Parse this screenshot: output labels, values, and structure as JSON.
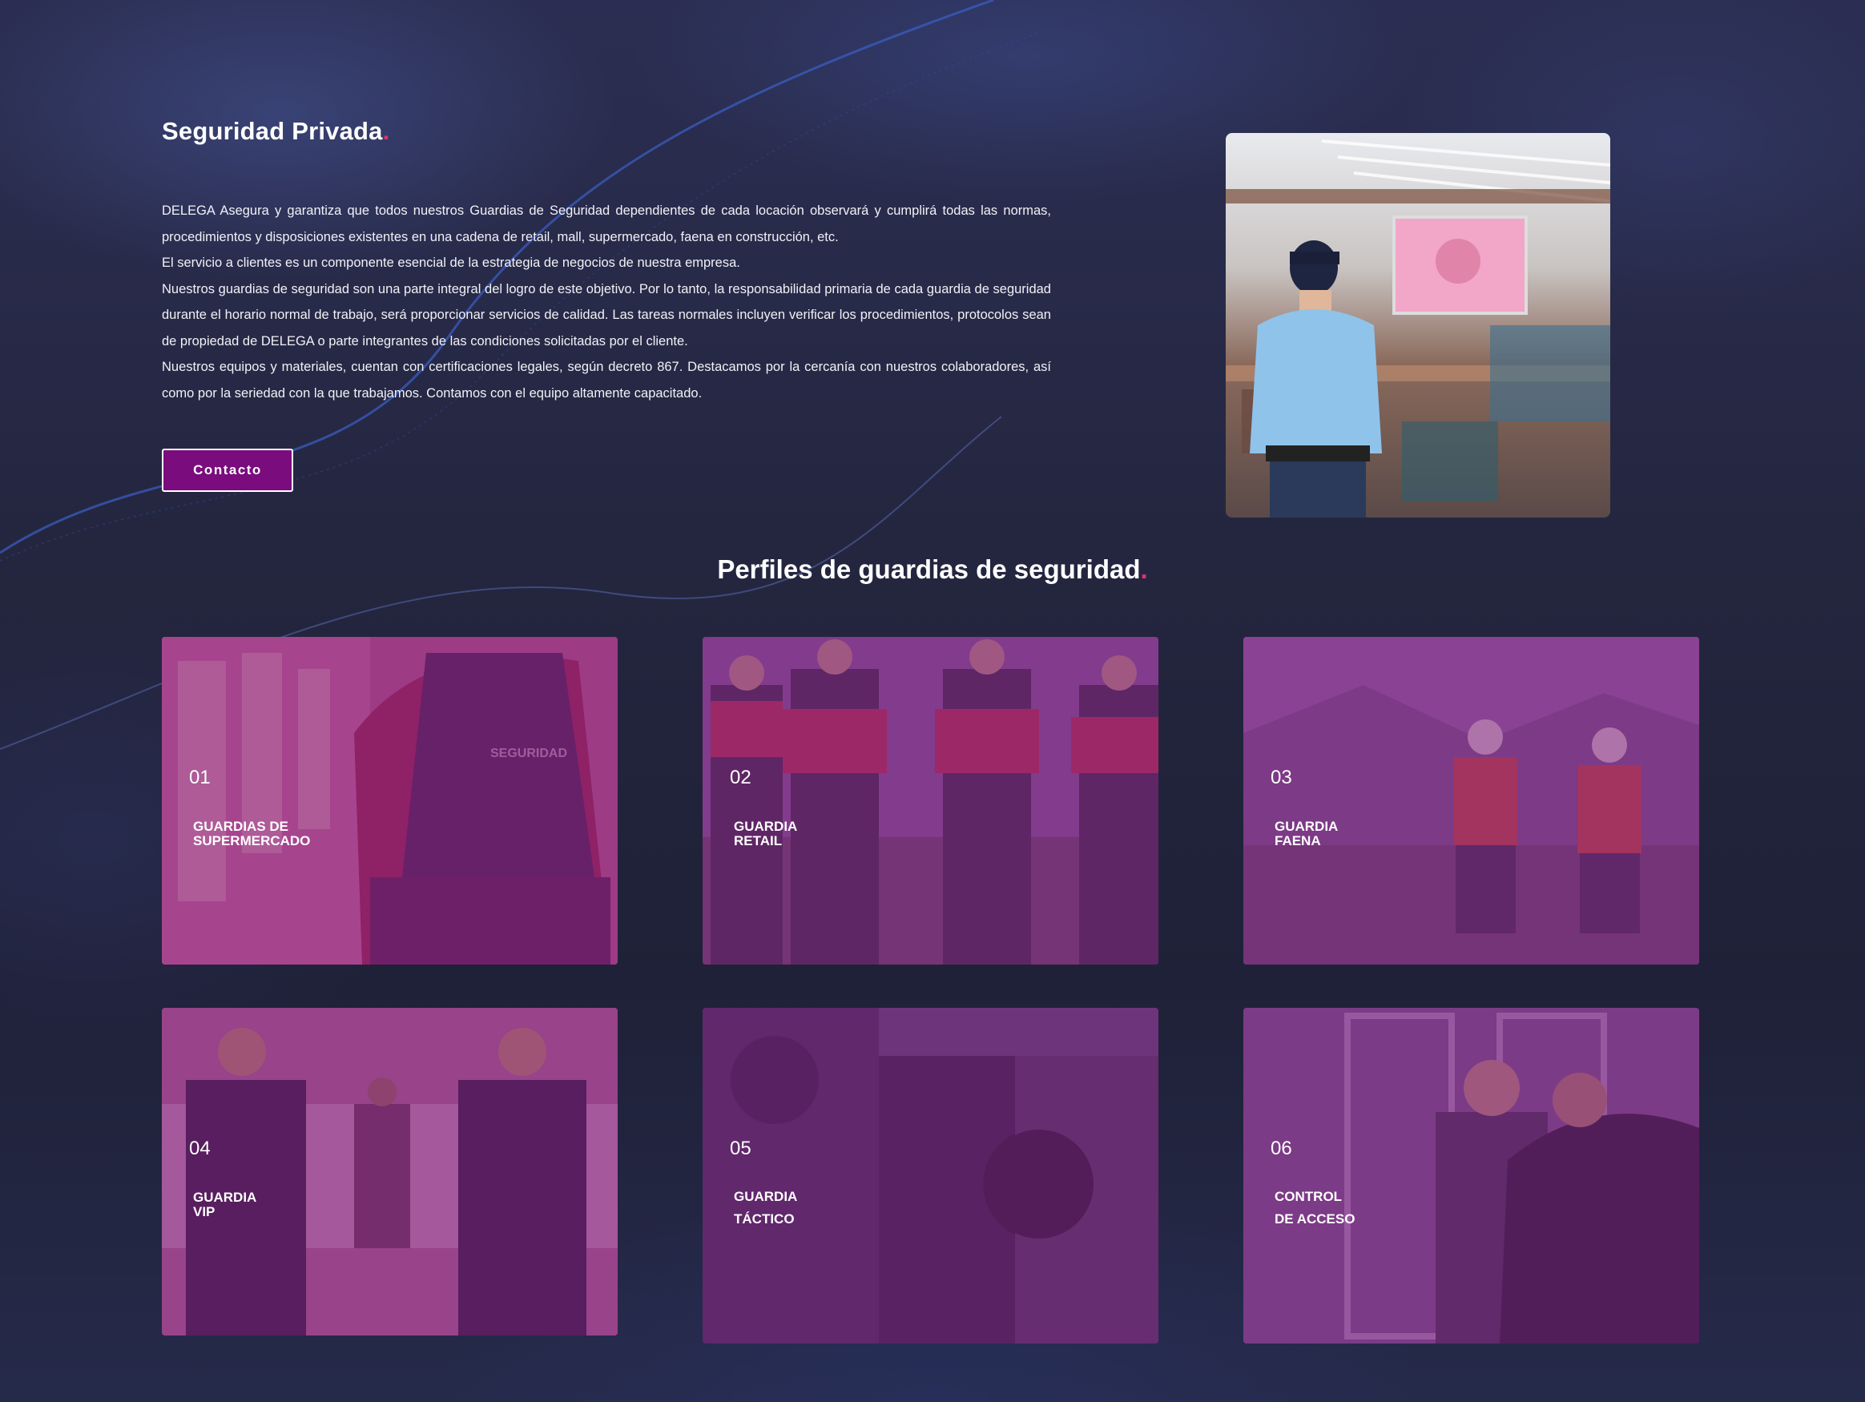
{
  "section": {
    "title": "Seguridad Privada",
    "paragraphs": [
      "DELEGA Asegura y garantiza que todos nuestros Guardias de Seguridad dependientes de cada locación observará y cumplirá todas las normas, procedimientos y disposiciones existentes en una cadena de retail, mall, supermercado, faena en construcción, etc.",
      "El servicio a clientes es un componente esencial de la estrategia de negocios de nuestra empresa.",
      "Nuestros guardias de seguridad son una parte integral del logro de este objetivo. Por lo tanto, la responsabilidad primaria de cada guardia de seguridad durante el horario normal de trabajo, será proporcionar servicios de calidad. Las tareas normales incluyen verificar los procedimientos, protocolos sean de propiedad de DELEGA o parte integrantes de las condiciones solicitadas por el cliente.",
      "Nuestros equipos y materiales, cuentan con certificaciones legales, según decreto 867. Destacamos por la cercanía con nuestros colaboradores, así como por la seriedad con la que trabajamos. Contamos con el equipo altamente capacitado."
    ],
    "button_label": "Contacto",
    "image_icon": "mall-security-guard-photo"
  },
  "profiles": {
    "title": "Perfiles de guardias de seguridad",
    "cards": [
      {
        "number": "01",
        "line1": "GUARDIAS DE",
        "line2": "SUPERMERCADO",
        "image_icon": "supermarket-guard-photo"
      },
      {
        "number": "02",
        "line1": "GUARDIA",
        "line2": "RETAIL",
        "image_icon": "retail-guards-photo"
      },
      {
        "number": "03",
        "line1": "GUARDIA",
        "line2": "FAENA",
        "image_icon": "site-workers-photo"
      },
      {
        "number": "04",
        "line1": "GUARDIA",
        "line2": "VIP",
        "image_icon": "vip-guards-photo"
      },
      {
        "number": "05",
        "line1": "GUARDIA",
        "line2": "TÁCTICO",
        "image_icon": "tactical-guard-photo"
      },
      {
        "number": "06",
        "line1": "CONTROL",
        "line2": "DE ACCESO",
        "image_icon": "access-control-photo"
      }
    ]
  },
  "colors": {
    "accent": "#7a0c7e",
    "dot": "#e0326e",
    "card_tint": "#7e227e",
    "background": "#232540"
  }
}
